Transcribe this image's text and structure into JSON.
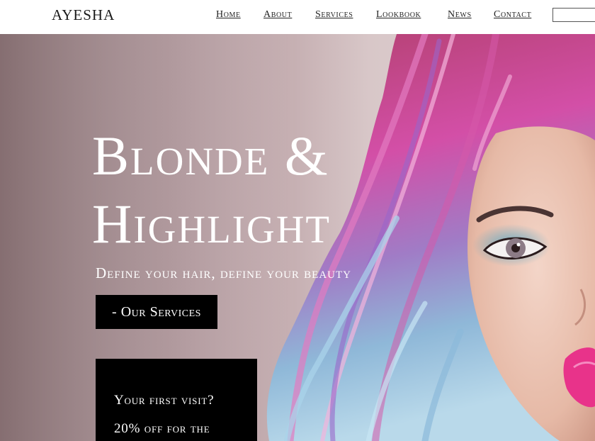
{
  "header": {
    "brand": "AYESHA",
    "nav": [
      "Home",
      "About",
      "Services",
      "Lookbook",
      "News",
      "Contact"
    ]
  },
  "hero": {
    "headline_line1": "Blonde &",
    "headline_line2": "Highlight",
    "tagline": "Define your hair, define your beauty",
    "cta_label": "- Our Services",
    "promo_line1": "Your first visit?",
    "promo_line2": "20% off for the"
  },
  "colors": {
    "cta_background": "#000000",
    "hair_pink": "#d0479e",
    "hair_blue": "#8ab8da"
  }
}
